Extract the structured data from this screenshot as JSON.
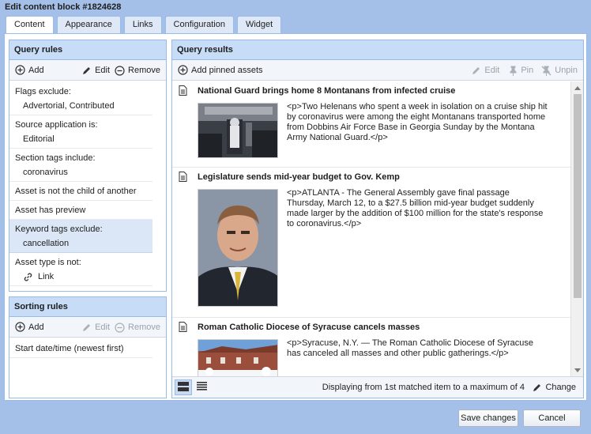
{
  "window": {
    "title": "Edit content block #1824628"
  },
  "tabs": [
    {
      "label": "Content",
      "active": true
    },
    {
      "label": "Appearance",
      "active": false
    },
    {
      "label": "Links",
      "active": false
    },
    {
      "label": "Configuration",
      "active": false
    },
    {
      "label": "Widget",
      "active": false
    }
  ],
  "query_rules": {
    "title": "Query rules",
    "toolbar": {
      "add": "Add",
      "edit": "Edit",
      "remove": "Remove"
    },
    "rules": [
      {
        "label": "Flags exclude:",
        "value": "Advertorial, Contributed"
      },
      {
        "label": "Source application is:",
        "value": "Editorial"
      },
      {
        "label": "Section tags include:",
        "value": "coronavirus"
      },
      {
        "label": "Asset is not the child of another"
      },
      {
        "label": "Asset has preview"
      },
      {
        "label": "Keyword tags exclude:",
        "value": "cancellation",
        "selected": true
      },
      {
        "label": "Asset type is not:",
        "value": "Link",
        "icon": "link-icon"
      }
    ]
  },
  "sorting_rules": {
    "title": "Sorting rules",
    "toolbar": {
      "add": "Add",
      "edit": "Edit",
      "remove": "Remove"
    },
    "rules": [
      {
        "label": "Start date/time (newest first)"
      }
    ]
  },
  "query_results": {
    "title": "Query results",
    "toolbar": {
      "add_pinned": "Add pinned assets",
      "edit": "Edit",
      "pin": "Pin",
      "unpin": "Unpin"
    },
    "items": [
      {
        "title": "National Guard brings home 8 Montanans from infected cruise",
        "text": "<p>Two Helenans who spent a week in isolation on a cruise ship hit by coronavirus were among the eight Montanans transported home from Dobbins Air Force Base in Georgia Sunday by the Montana Army National Guard.</p>"
      },
      {
        "title": "Legislature sends mid-year budget to Gov. Kemp",
        "text": "<p>ATLANTA - The General Assembly gave final passage Thursday, March 12, to a $27.5 billion mid-year budget suddenly made larger by the addition of $100 million for the state's response to coronavirus.</p>"
      },
      {
        "title": "Roman Catholic Diocese of Syracuse cancels masses",
        "text": "<p>Syracuse, N.Y. — The Roman Catholic Diocese of Syracuse has canceled all masses and other public gatherings.</p>"
      }
    ],
    "status": {
      "prefix": "Displaying from",
      "from": "1st",
      "middle": "matched item to a maximum of",
      "max": "4"
    },
    "change": "Change"
  },
  "footer": {
    "save": "Save changes",
    "cancel": "Cancel"
  },
  "colors": {
    "background": "#a4c0e8",
    "panel_header": "#c6dcf7",
    "border": "#99bbe8",
    "selected_row": "#dbe6f6"
  }
}
